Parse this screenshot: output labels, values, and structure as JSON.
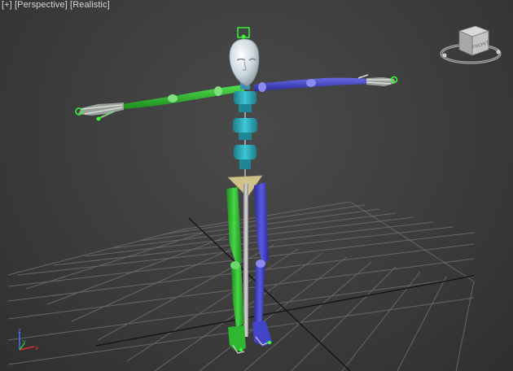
{
  "viewport": {
    "menu_plus": "[+]",
    "view_name": "[Perspective]",
    "shading_mode": "[Realistic]"
  },
  "viewcube": {
    "face_label": "FRONT",
    "icon": "viewcube-icon"
  },
  "axis_tripod": {
    "x_label": "x",
    "y_label": "y",
    "z_label": "z",
    "x_color": "#e03030",
    "y_color": "#30c030",
    "z_color": "#4070ff"
  },
  "scene": {
    "object": "biped-skeleton",
    "left_side_color": "#2fb82f",
    "right_side_color": "#4444c8",
    "spine_color": "#2aa7b8",
    "pelvis_color": "#cfc28a",
    "head_color": "#d9e6ec",
    "selection_color": "#33ff33"
  }
}
